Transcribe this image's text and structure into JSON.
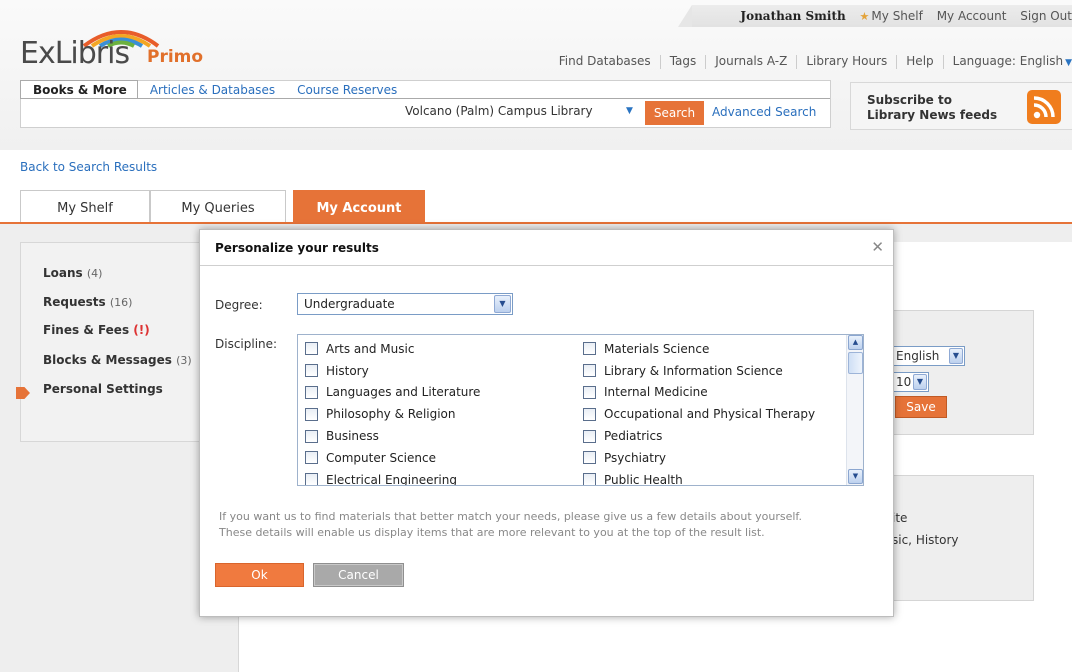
{
  "header": {
    "user_name": "Jonathan Smith",
    "user_links": [
      "My Shelf",
      "My Account",
      "Sign Out"
    ],
    "logo_main": "ExLibris",
    "logo_product": "Primo",
    "util_links": [
      "Find Databases",
      "Tags",
      "Journals A-Z",
      "Library Hours",
      "Help"
    ],
    "language_label": "Language:",
    "language_value": "English"
  },
  "search": {
    "tabs": [
      "Books & More",
      "Articles & Databases",
      "Course Reserves"
    ],
    "scope": "Volcano (Palm) Campus Library",
    "search_button": "Search",
    "advanced_link": "Advanced Search"
  },
  "rss": {
    "line1": "Subscribe to",
    "line2": "Library News feeds"
  },
  "page": {
    "back_link": "Back to Search Results",
    "account_tabs": [
      "My Shelf",
      "My Queries",
      "My Account"
    ]
  },
  "left_nav": {
    "loans_label": "Loans",
    "loans_count": "(4)",
    "requests_label": "Requests",
    "requests_count": "(16)",
    "fines_label": "Fines & Fees",
    "fines_alert": "(!)",
    "blocks_label": "Blocks & Messages",
    "blocks_count": "(3)",
    "settings_label": "Personal Settings"
  },
  "background_settings": {
    "language_value": "English",
    "results_value": "10",
    "save_label": "Save",
    "degree_partial": "ite",
    "discipline_partial": "sic, History"
  },
  "modal": {
    "title": "Personalize your results",
    "degree_label": "Degree:",
    "degree_value": "Undergraduate",
    "discipline_label": "Discipline:",
    "disciplines_left": [
      "Arts and Music",
      "History",
      "Languages and Literature",
      "Philosophy & Religion",
      "Business",
      "Computer Science",
      "Electrical Engineering"
    ],
    "disciplines_right": [
      "Materials Science",
      "Library & Information Science",
      "Internal Medicine",
      "Occupational and Physical Therapy",
      "Pediatrics",
      "Psychiatry",
      "Public Health"
    ],
    "info_line1": "If you want us to find materials that better match your needs, please give us a few details about yourself.",
    "info_line2": "These details will enable us display items that are more relevant to you at the top of the result list.",
    "ok_label": "Ok",
    "cancel_label": "Cancel"
  },
  "colors": {
    "accent": "#e67338",
    "link": "#2a6fbd"
  }
}
